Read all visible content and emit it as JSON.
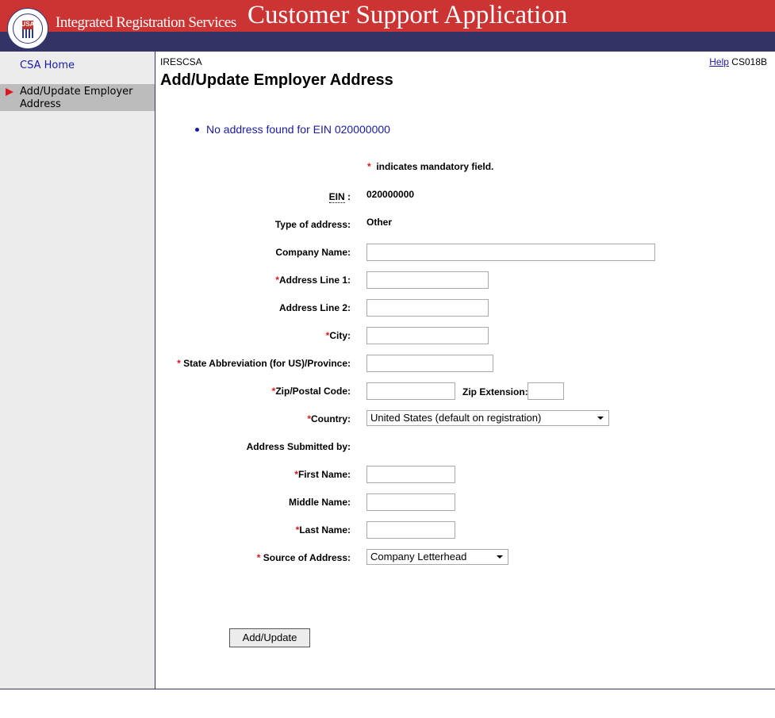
{
  "header": {
    "brand": "Integrated Registration Services",
    "app_title": "Customer Support Application",
    "seal_text": "USA",
    "colors": {
      "top_bar": "#cc3333",
      "sub_bar": "#333366"
    }
  },
  "sidebar": {
    "home": "CSA Home",
    "active_item": "Add/Update Employer Address"
  },
  "main": {
    "system_id": "IRESCSA",
    "help": "Help",
    "screen_code": "CS018B",
    "title": "Add/Update Employer Address",
    "message": "No address found for EIN 020000000",
    "mandatory_note": "indicates mandatory field.",
    "mandatory_marker": "*"
  },
  "form": {
    "ein_label": "EIN",
    "ein_suffix": " :",
    "ein_value": "020000000",
    "type_label": "Type of address:",
    "type_value": "Other",
    "company_name_label": "Company Name:",
    "address1_label": "Address Line 1:",
    "address2_label": "Address Line 2:",
    "city_label": "City:",
    "state_label": "State Abbreviation (for US)/Province:",
    "zip_label": "Zip/Postal Code:",
    "zip_ext_label": "Zip Extension:",
    "country_label": "Country:",
    "country_value": "United States (default on registration)",
    "submitted_by_label": "Address Submitted by:",
    "first_name_label": "First Name:",
    "middle_name_label": "Middle Name:",
    "last_name_label": "Last Name:",
    "source_label": "Source of Address:",
    "source_value": "Company Letterhead",
    "submit_button": "Add/Update"
  }
}
